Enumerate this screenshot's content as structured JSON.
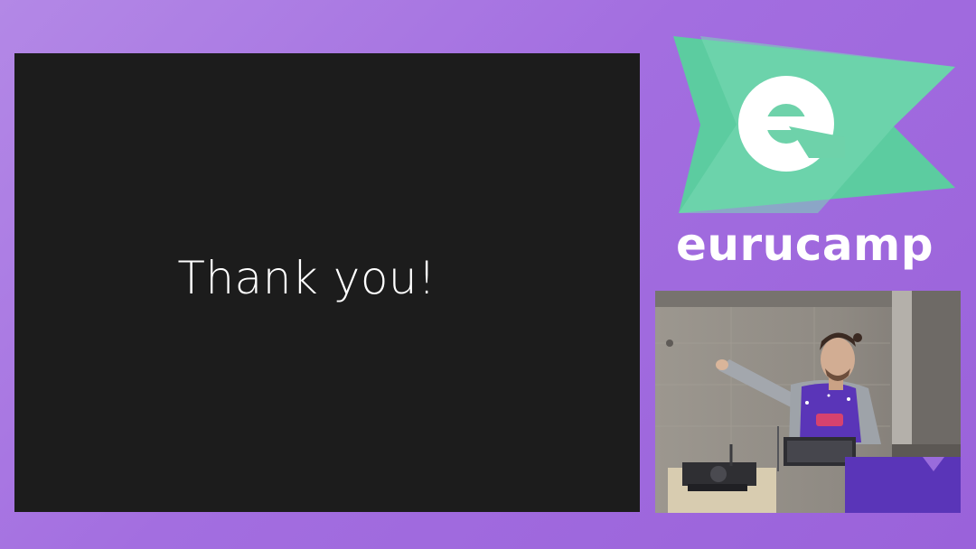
{
  "slide": {
    "text": "Thank you!"
  },
  "branding": {
    "logo_letter": "e",
    "name": "eurucamp",
    "colors": {
      "background": "#a36ee0",
      "flag_green": "#5ccca0",
      "flag_light_green": "#7ad8b4",
      "text": "#ffffff"
    }
  },
  "camera": {
    "shirt_color": "#5a35b8"
  }
}
